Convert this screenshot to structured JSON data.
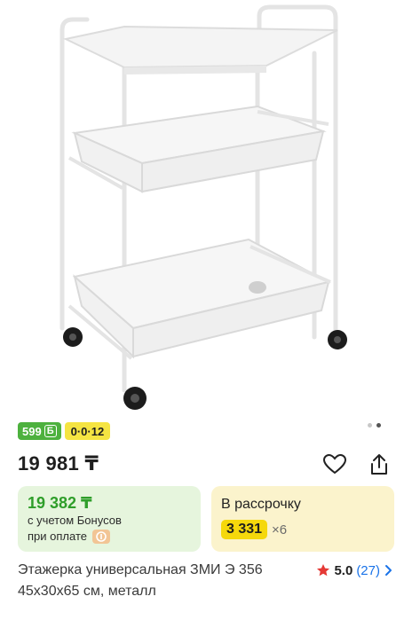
{
  "gallery": {
    "image_alt": "Этажерка на колесах, белая",
    "dot_count": 2,
    "active_dot": 1
  },
  "badges": {
    "bonus_value": "599",
    "bonus_symbol": "Б",
    "installment_plan": "0·0·12"
  },
  "price": {
    "main": "19 981 ₸"
  },
  "bonus_card": {
    "price": "19 382 ₸",
    "line1": "с учетом Бонусов",
    "line2": "при оплате"
  },
  "installment_card": {
    "title": "В рассрочку",
    "amount": "3 331",
    "months": "×6"
  },
  "product": {
    "title": "Этажерка универсальная ЗМИ Э 356 45х30х65 см, металл",
    "rating": "5.0",
    "reviews": "(27)"
  },
  "colors": {
    "bonus_green": "#4db13e",
    "installment_yellow": "#f5e442",
    "bonus_card_bg": "#e6f5dd",
    "installment_card_bg": "#fbf3cc",
    "star_red": "#e53935",
    "link_blue": "#1a73e8"
  },
  "icons": {
    "favorite": "heart-icon",
    "share": "share-icon",
    "rating": "star-icon",
    "more": "chevron-right-icon",
    "kaspi": "kaspi-icon"
  }
}
